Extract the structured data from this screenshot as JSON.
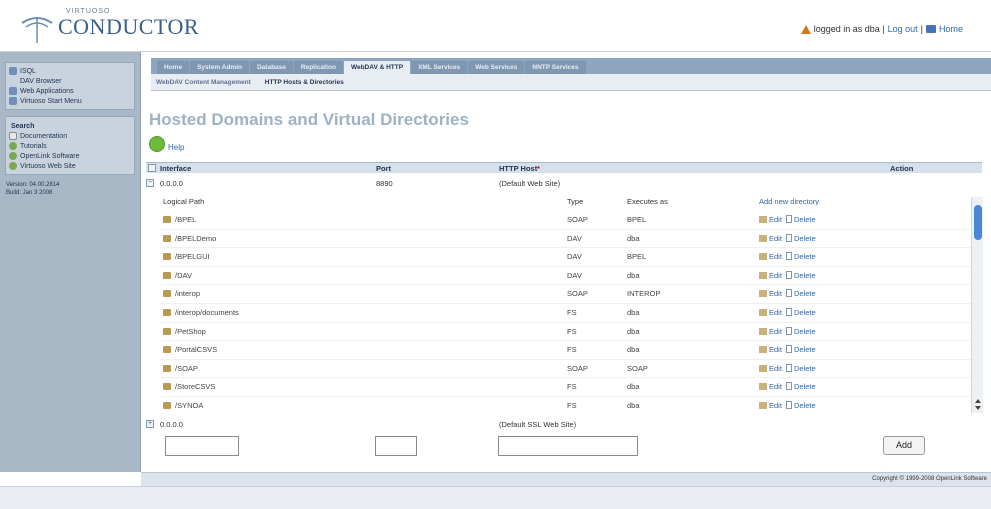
{
  "header": {
    "logo_small": "VIRTUOSO",
    "logo_text": "CONDUCTOR",
    "logged_in_text": "logged in as dba |",
    "logout_label": "Log out",
    "separator": "|",
    "home_label": "Home"
  },
  "sidebar": {
    "tools": [
      {
        "label": "ISQL",
        "icon": "isql-icon"
      },
      {
        "label": "DAV Browser",
        "icon": "folder-icon"
      },
      {
        "label": "Web Applications",
        "icon": "apps-icon"
      },
      {
        "label": "Virtuoso Start Menu",
        "icon": "start-icon"
      }
    ],
    "search_label": "Search",
    "links": [
      {
        "label": "Documentation"
      },
      {
        "label": "Tutorials"
      },
      {
        "label": "OpenLink Software"
      },
      {
        "label": "Virtuoso Web Site"
      }
    ],
    "version": "Version: 04.00.2814",
    "build": "Build: Jan 3 2008"
  },
  "tabs": [
    {
      "label": "Home",
      "active": false
    },
    {
      "label": "System Admin",
      "active": false
    },
    {
      "label": "Database",
      "active": false
    },
    {
      "label": "Replication",
      "active": false
    },
    {
      "label": "WebDAV & HTTP",
      "active": true
    },
    {
      "label": "XML Services",
      "active": false
    },
    {
      "label": "Web Services",
      "active": false
    },
    {
      "label": "NNTP Services",
      "active": false
    }
  ],
  "subtabs": [
    {
      "label": "WebDAV Content Management",
      "active": false
    },
    {
      "label": "HTTP Hosts & Directories",
      "active": true
    }
  ],
  "page_title": "Hosted Domains and Virtual Directories",
  "help_label": "Help",
  "table": {
    "headers": {
      "interface": "Interface",
      "port": "Port",
      "http_host": "HTTP Host",
      "http_host_mark": "*",
      "action": "Action"
    },
    "host1": {
      "interface": "0.0.0.0",
      "port": "8890",
      "http_host": "(Default Web Site)"
    },
    "dir_headers": {
      "path": "Logical Path",
      "type": "Type",
      "executes_as": "Executes as",
      "add_new": "Add new directory"
    },
    "directories": [
      {
        "path": "/BPEL",
        "type": "SOAP",
        "exec": "BPEL",
        "edit": "Edit",
        "delete": "Delete"
      },
      {
        "path": "/BPELDemo",
        "type": "DAV",
        "exec": "dba",
        "edit": "Edit",
        "delete": "Delete"
      },
      {
        "path": "/BPELGUI",
        "type": "DAV",
        "exec": "BPEL",
        "edit": "Edit",
        "delete": "Delete"
      },
      {
        "path": "/DAV",
        "type": "DAV",
        "exec": "dba",
        "edit": "Edit",
        "delete": "Delete"
      },
      {
        "path": "/interop",
        "type": "SOAP",
        "exec": "INTEROP",
        "edit": "Edit",
        "delete": "Delete"
      },
      {
        "path": "/interop/documents",
        "type": "FS",
        "exec": "dba",
        "edit": "Edit",
        "delete": "Delete"
      },
      {
        "path": "/PetShop",
        "type": "FS",
        "exec": "dba",
        "edit": "Edit",
        "delete": "Delete"
      },
      {
        "path": "/PortalCSVS",
        "type": "FS",
        "exec": "dba",
        "edit": "Edit",
        "delete": "Delete"
      },
      {
        "path": "/SOAP",
        "type": "SOAP",
        "exec": "SOAP",
        "edit": "Edit",
        "delete": "Delete"
      },
      {
        "path": "/StoreCSVS",
        "type": "FS",
        "exec": "dba",
        "edit": "Edit",
        "delete": "Delete"
      },
      {
        "path": "/SYNOA",
        "type": "FS",
        "exec": "dba",
        "edit": "Edit",
        "delete": "Delete"
      }
    ],
    "host2": {
      "interface": "0.0.0.0",
      "http_host": "(Default SSL Web Site)"
    },
    "add_button": "Add",
    "new_interface_value": "",
    "new_port_value": "",
    "new_host_value": ""
  },
  "footer": "Copyright © 1999-2008 OpenLink Software",
  "colors": {
    "accent": "#3366aa",
    "tabbar": "#8da5be",
    "sidebar": "#a9b8c7",
    "title": "#9eb2c6"
  }
}
